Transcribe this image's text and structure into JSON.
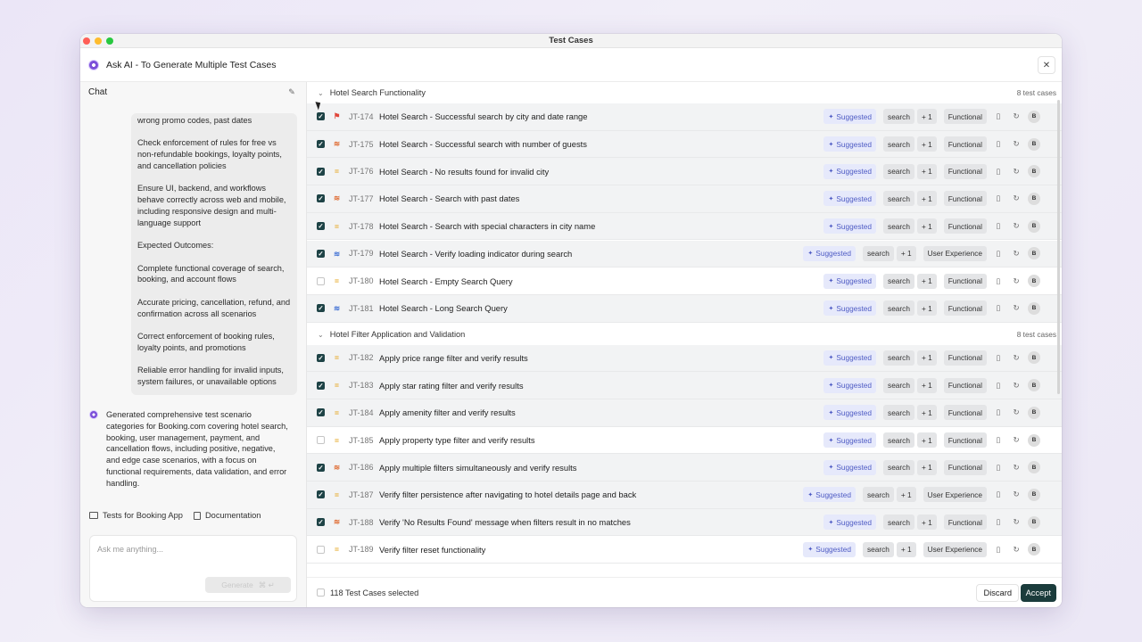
{
  "window": {
    "title": "Test Cases"
  },
  "header": {
    "title": "Ask AI - To Generate Multiple Test Cases",
    "close_label": "✕"
  },
  "chat": {
    "label": "Chat",
    "bubble": [
      "wrong promo codes, past dates",
      "Check enforcement of rules for free vs non-refundable bookings, loyalty points, and cancellation policies",
      "Ensure UI, backend, and workflows behave correctly across web and mobile, including responsive design and multi-language support",
      "Expected Outcomes:",
      "Complete functional coverage of search, booking, and account flows",
      "Accurate pricing, cancellation, refund, and confirmation across all scenarios",
      "Correct enforcement of booking rules, loyalty points, and promotions",
      "Reliable error handling for invalid inputs, system failures, or unavailable options"
    ],
    "ai_message": "Generated comprehensive test scenario categories for Booking.com covering hotel search, booking, user management, payment, and cancellation flows, including positive, negative, and edge case scenarios, with a focus on functional requirements, data validation, and error handling.",
    "link_tests": "Tests for Booking App",
    "link_docs": "Documentation",
    "input_placeholder": "Ask me anything...",
    "generate_label": "Generate",
    "generate_shortcut": "⌘ ↵"
  },
  "groups": [
    {
      "name": "Hotel Search Functionality",
      "count": "8 test cases",
      "rows": [
        {
          "checked": true,
          "priority": "critical",
          "id": "JT-174",
          "title": "Hotel Search - Successful search by city and date range",
          "tag": "search",
          "more": "+ 1",
          "type": "Functional"
        },
        {
          "checked": true,
          "priority": "high",
          "id": "JT-175",
          "title": "Hotel Search - Successful search with number of guests",
          "tag": "search",
          "more": "+ 1",
          "type": "Functional"
        },
        {
          "checked": true,
          "priority": "medium",
          "id": "JT-176",
          "title": "Hotel Search - No results found for invalid city",
          "tag": "search",
          "more": "+ 1",
          "type": "Functional"
        },
        {
          "checked": true,
          "priority": "high",
          "id": "JT-177",
          "title": "Hotel Search - Search with past dates",
          "tag": "search",
          "more": "+ 1",
          "type": "Functional"
        },
        {
          "checked": true,
          "priority": "medium",
          "id": "JT-178",
          "title": "Hotel Search - Search with special characters in city name",
          "tag": "search",
          "more": "+ 1",
          "type": "Functional"
        },
        {
          "checked": true,
          "priority": "low",
          "id": "JT-179",
          "title": "Hotel Search - Verify loading indicator during search",
          "tag": "search",
          "more": "+ 1",
          "type": "User Experience"
        },
        {
          "checked": false,
          "priority": "medium",
          "id": "JT-180",
          "title": "Hotel Search - Empty Search Query",
          "tag": "search",
          "more": "+ 1",
          "type": "Functional"
        },
        {
          "checked": true,
          "priority": "low",
          "id": "JT-181",
          "title": "Hotel Search - Long Search Query",
          "tag": "search",
          "more": "+ 1",
          "type": "Functional"
        }
      ]
    },
    {
      "name": "Hotel Filter Application and Validation",
      "count": "8 test cases",
      "rows": [
        {
          "checked": true,
          "priority": "medium",
          "id": "JT-182",
          "title": "Apply price range filter and verify results",
          "tag": "search",
          "more": "+ 1",
          "type": "Functional"
        },
        {
          "checked": true,
          "priority": "medium",
          "id": "JT-183",
          "title": "Apply star rating filter and verify results",
          "tag": "search",
          "more": "+ 1",
          "type": "Functional"
        },
        {
          "checked": true,
          "priority": "medium",
          "id": "JT-184",
          "title": "Apply amenity filter and verify results",
          "tag": "search",
          "more": "+ 1",
          "type": "Functional"
        },
        {
          "checked": false,
          "priority": "medium",
          "id": "JT-185",
          "title": "Apply property type filter and verify results",
          "tag": "search",
          "more": "+ 1",
          "type": "Functional"
        },
        {
          "checked": true,
          "priority": "high",
          "id": "JT-186",
          "title": "Apply multiple filters simultaneously and verify results",
          "tag": "search",
          "more": "+ 1",
          "type": "Functional"
        },
        {
          "checked": true,
          "priority": "medium",
          "id": "JT-187",
          "title": "Verify filter persistence after navigating to hotel details page and back",
          "tag": "search",
          "more": "+ 1",
          "type": "User Experience"
        },
        {
          "checked": true,
          "priority": "high",
          "id": "JT-188",
          "title": "Verify 'No Results Found' message when filters result in no matches",
          "tag": "search",
          "more": "+ 1",
          "type": "Functional"
        },
        {
          "checked": false,
          "priority": "medium",
          "id": "JT-189",
          "title": "Verify filter reset functionality",
          "tag": "search",
          "more": "+ 1",
          "type": "User Experience"
        }
      ]
    }
  ],
  "suggested_label": "Suggested",
  "avatar_initial": "B",
  "footer": {
    "selected": "118 Test Cases selected",
    "discard": "Discard",
    "accept": "Accept"
  },
  "colors": {
    "critical": "#e0453a",
    "high": "#e0713a",
    "medium": "#e5a51e",
    "low": "#4a78d6",
    "accent": "#1b3c3c"
  },
  "icons": {
    "critical": "flag-icon",
    "high": "chevrons-up-icon",
    "medium": "equals-icon",
    "low": "chevrons-down-icon"
  }
}
